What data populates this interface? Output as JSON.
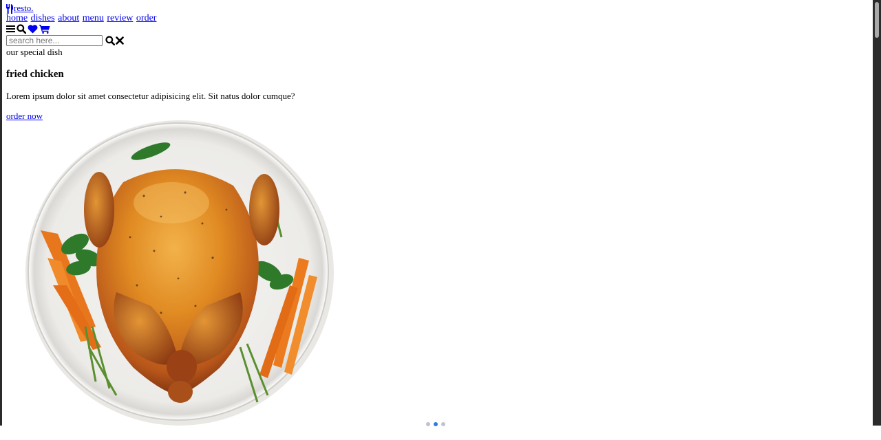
{
  "brand": {
    "name": "resto.",
    "icon": "utensils-icon"
  },
  "nav": {
    "items": [
      {
        "label": "home"
      },
      {
        "label": "dishes"
      },
      {
        "label": "about"
      },
      {
        "label": "menu"
      },
      {
        "label": "review"
      },
      {
        "label": "order"
      }
    ]
  },
  "icons": [
    "menu-bars-icon",
    "search-icon",
    "heart-icon",
    "cart-icon"
  ],
  "search": {
    "placeholder": "search here...",
    "value": ""
  },
  "slide": {
    "subtitle": "our special dish",
    "title": "fried chicken",
    "description": "Lorem ipsum dolor sit amet consectetur adipisicing elit. Sit natus dolor cumque?",
    "cta": "order now",
    "image_alt": "roasted chicken on a plate with carrots and herbs"
  },
  "slider": {
    "count": 3,
    "active": 2
  },
  "colors": {
    "link": "#0000ee",
    "scrollbar": "#2b2b2b",
    "dot_active": "#2a7de1",
    "dot_inactive": "#bfc4cc"
  }
}
